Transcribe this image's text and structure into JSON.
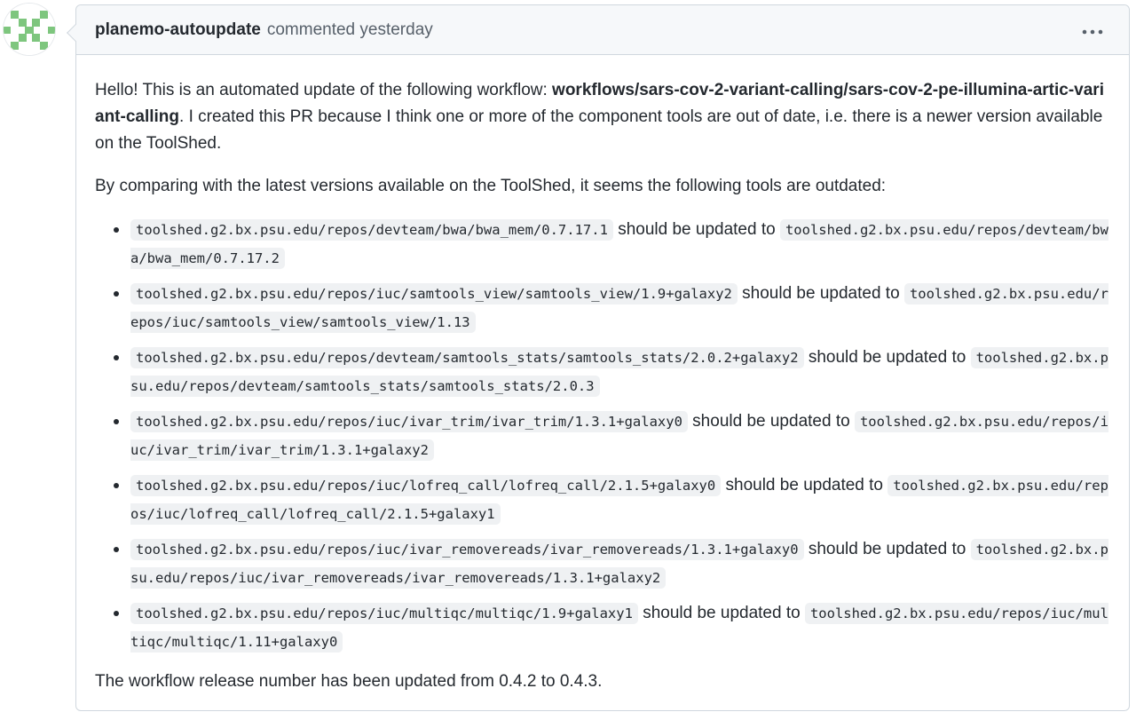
{
  "comment": {
    "author": "planemo-autoupdate",
    "meta": "commented yesterday",
    "menu_icon": "kebab-horizontal-icon",
    "intro_prefix": "Hello! This is an automated update of the following workflow: ",
    "workflow_path": "workflows/sars-cov-2-variant-calling/sars-cov-2-pe-illumina-artic-variant-calling",
    "intro_suffix": ". I created this PR because I think one or more of the component tools are out of date, i.e. there is a newer version available on the ToolShed.",
    "compare_text": "By comparing with the latest versions available on the ToolShed, it seems the following tools are outdated:",
    "connector_text": " should be updated to ",
    "tools": [
      {
        "from": "toolshed.g2.bx.psu.edu/repos/devteam/bwa/bwa_mem/0.7.17.1",
        "to": "toolshed.g2.bx.psu.edu/repos/devteam/bwa/bwa_mem/0.7.17.2"
      },
      {
        "from": "toolshed.g2.bx.psu.edu/repos/iuc/samtools_view/samtools_view/1.9+galaxy2",
        "to": "toolshed.g2.bx.psu.edu/repos/iuc/samtools_view/samtools_view/1.13"
      },
      {
        "from": "toolshed.g2.bx.psu.edu/repos/devteam/samtools_stats/samtools_stats/2.0.2+galaxy2",
        "to": "toolshed.g2.bx.psu.edu/repos/devteam/samtools_stats/samtools_stats/2.0.3"
      },
      {
        "from": "toolshed.g2.bx.psu.edu/repos/iuc/ivar_trim/ivar_trim/1.3.1+galaxy0",
        "to": "toolshed.g2.bx.psu.edu/repos/iuc/ivar_trim/ivar_trim/1.3.1+galaxy2"
      },
      {
        "from": "toolshed.g2.bx.psu.edu/repos/iuc/lofreq_call/lofreq_call/2.1.5+galaxy0",
        "to": "toolshed.g2.bx.psu.edu/repos/iuc/lofreq_call/lofreq_call/2.1.5+galaxy1"
      },
      {
        "from": "toolshed.g2.bx.psu.edu/repos/iuc/ivar_removereads/ivar_removereads/1.3.1+galaxy0",
        "to": "toolshed.g2.bx.psu.edu/repos/iuc/ivar_removereads/ivar_removereads/1.3.1+galaxy2"
      },
      {
        "from": "toolshed.g2.bx.psu.edu/repos/iuc/multiqc/multiqc/1.9+galaxy1",
        "to": "toolshed.g2.bx.psu.edu/repos/iuc/multiqc/multiqc/1.11+galaxy0"
      }
    ],
    "release_text": "The workflow release number has been updated from 0.4.2 to 0.4.3."
  },
  "colors": {
    "avatar": "#7ec67e",
    "border": "#d0d7de",
    "header_bg": "#f6f8fa",
    "code_bg": "#eff1f3"
  }
}
